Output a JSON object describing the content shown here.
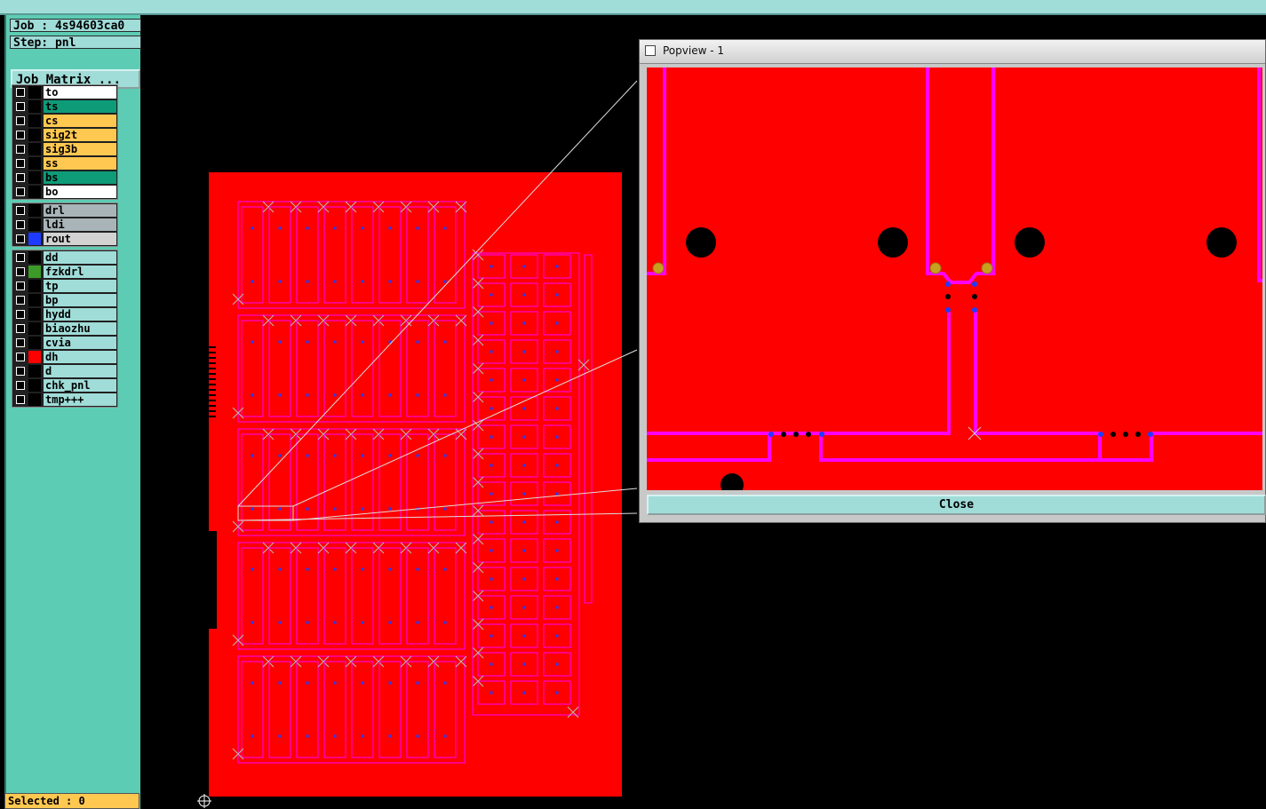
{
  "header": {
    "job_label": "Job : 4s94603ca0",
    "step_label": "Step: pnl",
    "job_matrix_button": "Job Matrix ..."
  },
  "layers": {
    "group1": [
      {
        "name": "to",
        "color": "#ffffff",
        "swatch": "#000000"
      },
      {
        "name": "ts",
        "color": "#0e9b78",
        "swatch": "#000000"
      },
      {
        "name": "cs",
        "color": "#ffc850",
        "swatch": "#000000"
      },
      {
        "name": "sig2t",
        "color": "#ffc850",
        "swatch": "#000000"
      },
      {
        "name": "sig3b",
        "color": "#ffc850",
        "swatch": "#000000"
      },
      {
        "name": "ss",
        "color": "#ffc850",
        "swatch": "#000000"
      },
      {
        "name": "bs",
        "color": "#0e9b78",
        "swatch": "#000000"
      },
      {
        "name": "bo",
        "color": "#ffffff",
        "swatch": "#000000"
      }
    ],
    "group2": [
      {
        "name": "drl",
        "color": "#a8b4b8",
        "swatch": "#000000"
      },
      {
        "name": "ldi",
        "color": "#a8b4b8",
        "swatch": "#000000"
      },
      {
        "name": "rout",
        "color": "#d2d2d2",
        "swatch": "#1e3cff"
      }
    ],
    "group3": [
      {
        "name": "dd",
        "color": "#a0dcd8",
        "swatch": "#000000"
      },
      {
        "name": "fzkdrl",
        "color": "#a0dcd8",
        "swatch": "#3c9a28"
      },
      {
        "name": "tp",
        "color": "#a0dcd8",
        "swatch": "#000000"
      },
      {
        "name": "bp",
        "color": "#a0dcd8",
        "swatch": "#000000"
      },
      {
        "name": "hydd",
        "color": "#a0dcd8",
        "swatch": "#000000"
      },
      {
        "name": "biaozhu",
        "color": "#a0dcd8",
        "swatch": "#000000"
      },
      {
        "name": "cvia",
        "color": "#a0dcd8",
        "swatch": "#000000"
      },
      {
        "name": "dh",
        "color": "#a0dcd8",
        "swatch": "#ff0000"
      },
      {
        "name": "d",
        "color": "#a0dcd8",
        "swatch": "#000000"
      },
      {
        "name": "chk_pnl",
        "color": "#a0dcd8",
        "swatch": "#000000"
      },
      {
        "name": "tmp+++",
        "color": "#a0dcd8",
        "swatch": "#000000"
      }
    ]
  },
  "status": {
    "selected_label": "Selected : 0"
  },
  "popview": {
    "title": "Popview - 1",
    "close_button": "Close"
  },
  "colors": {
    "copper": "#ff0000",
    "trace": "#ff00ff",
    "pad": "#1e3cff",
    "mark": "#c8a020",
    "panel_teal": "#5ccdb4",
    "light_teal": "#a0dcd8"
  }
}
